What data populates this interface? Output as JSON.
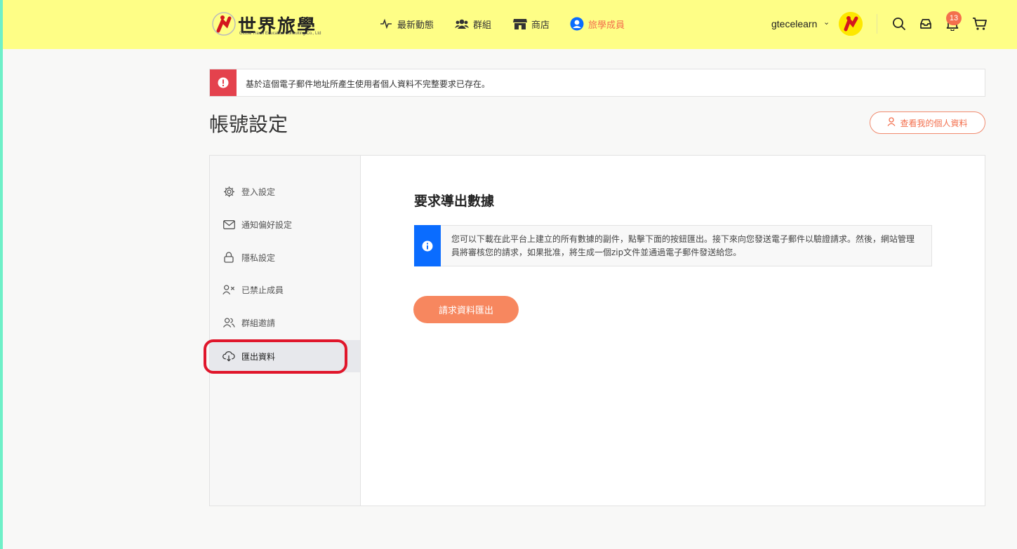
{
  "header": {
    "logo_text": "世界旅學",
    "logo_subtitle": "Global Travel Education Consulting Co., Ltd",
    "nav": [
      {
        "label": "最新動態",
        "icon": "activity-icon"
      },
      {
        "label": "群組",
        "icon": "users-icon"
      },
      {
        "label": "商店",
        "icon": "store-icon"
      },
      {
        "label": "旅學成員",
        "icon": "user-circle-icon",
        "active": true
      }
    ],
    "username": "gtecelearn",
    "notification_count": "13",
    "colors": {
      "background": "#fefe86",
      "accent": "#f36f4d"
    }
  },
  "alert": {
    "message": "基於這個電子郵件地址所產生使用者個人資料不完整要求已存在。",
    "color": "#e4424d"
  },
  "page": {
    "title": "帳號設定",
    "view_profile_label": "查看我的個人資料"
  },
  "sidebar": {
    "items": [
      {
        "label": "登入設定",
        "icon": "gear-icon"
      },
      {
        "label": "通知偏好設定",
        "icon": "mail-icon"
      },
      {
        "label": "隱私設定",
        "icon": "lock-icon"
      },
      {
        "label": "已禁止成員",
        "icon": "user-blocked-icon"
      },
      {
        "label": "群組邀請",
        "icon": "group-icon"
      },
      {
        "label": "匯出資料",
        "icon": "cloud-download-icon",
        "active": true
      }
    ]
  },
  "main": {
    "section_title": "要求導出數據",
    "info_text": "您可以下載在此平台上建立的所有數據的副件，點擊下面的按鈕匯出。接下來向您發送電子郵件以驗證請求。然後，網站管理員將審核您的請求，如果批准，將生成一個zip文件並通過電子郵件發送給您。",
    "info_color": "#0a6cff",
    "export_button_label": "請求資料匯出",
    "button_color": "#f7875f"
  }
}
